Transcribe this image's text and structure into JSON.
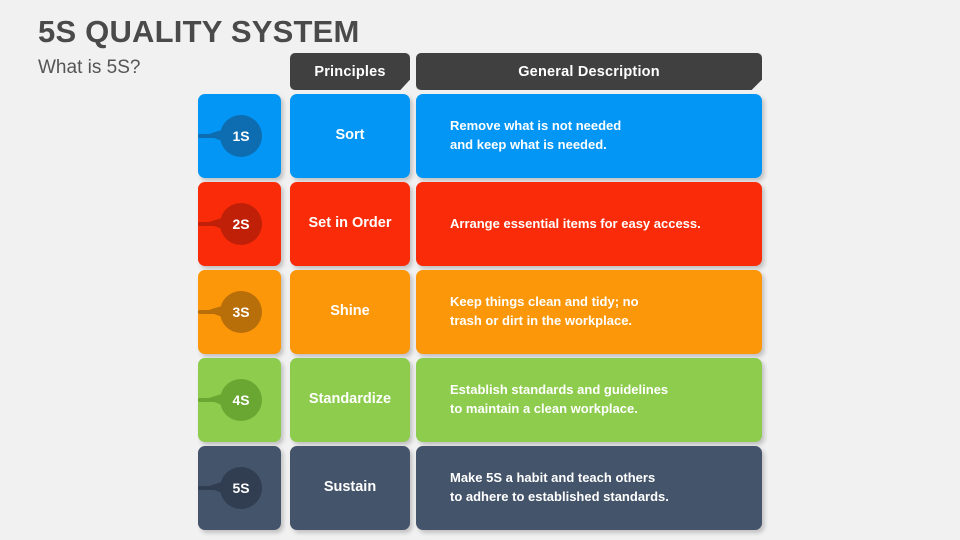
{
  "slide": {
    "background_color": "#f1f1f1",
    "title": "5S QUALITY SYSTEM",
    "subtitle": "What is 5S?",
    "title_color": "#4a4a4a"
  },
  "table": {
    "header": {
      "background_color": "#404040",
      "principles_label": "Principles",
      "description_label": "General Description"
    },
    "rows": [
      {
        "badge": "1S",
        "principle": "Sort",
        "description": "Remove what is not needed\nand keep what is needed.",
        "color": "#0496f5",
        "badge_color": "#0e6cb0"
      },
      {
        "badge": "2S",
        "principle": "Set in Order",
        "description": "Arrange essential items for easy access.",
        "color": "#f92b09",
        "badge_color": "#c02008"
      },
      {
        "badge": "3S",
        "principle": "Shine",
        "description": "Keep things clean and tidy; no\ntrash or dirt in the workplace.",
        "color": "#fb9709",
        "badge_color": "#b86e09"
      },
      {
        "badge": "4S",
        "principle": "Standardize",
        "description": "Establish standards and guidelines\nto maintain a clean workplace.",
        "color": "#8dcc4d",
        "badge_color": "#6aa632"
      },
      {
        "badge": "5S",
        "principle": "Sustain",
        "description": "Make 5S a habit and teach others\nto adhere to established standards.",
        "color": "#44546a",
        "badge_color": "#313d50"
      }
    ]
  }
}
